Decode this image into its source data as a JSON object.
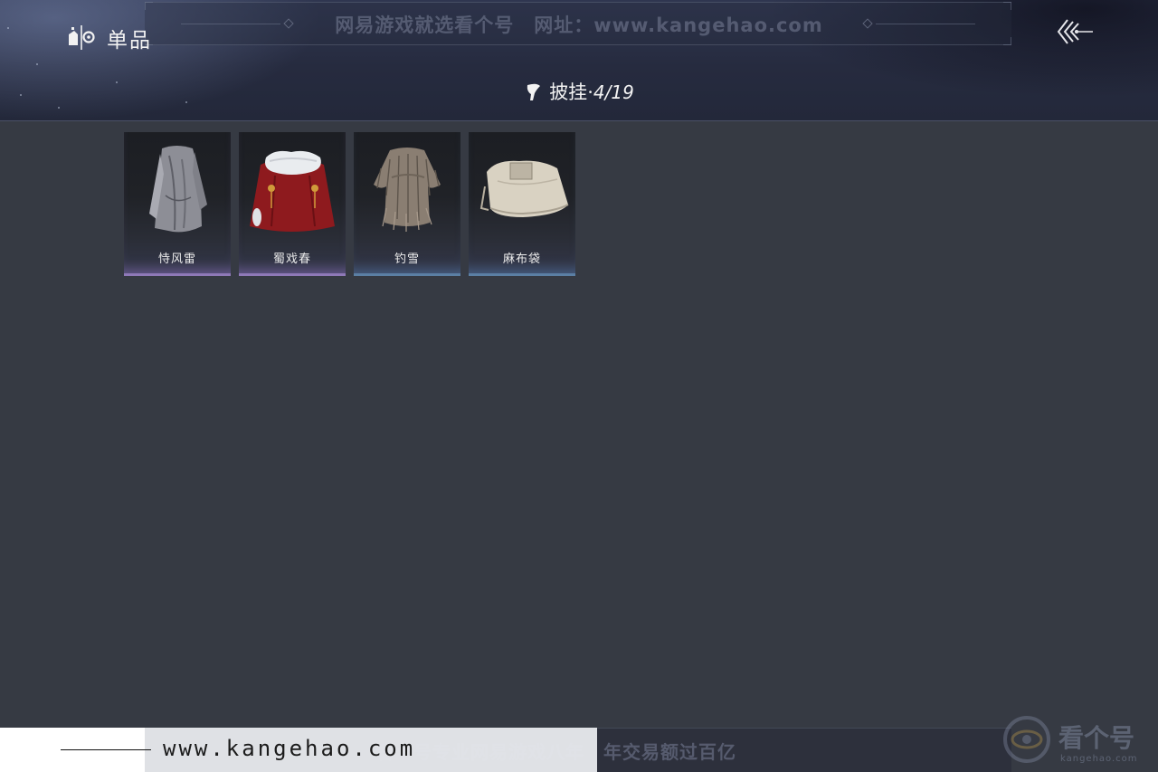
{
  "header": {
    "title": "单品",
    "watermark": "网易游戏就选看个号　网址：www.kangehao.com",
    "logo_icon": "wardrobe-logo-icon",
    "back_icon": "triple-arrow-back-icon"
  },
  "category": {
    "icon": "cape-icon",
    "label": "披挂",
    "separator": "·",
    "count": "4/19"
  },
  "items": [
    {
      "name": "恃风雷",
      "rarity_color": "#8f79b8",
      "icon": "grey-robe-icon"
    },
    {
      "name": "蜀戏春",
      "rarity_color": "#8f79b8",
      "icon": "red-fur-cape-icon"
    },
    {
      "name": "钓雪",
      "rarity_color": "#5b7fa4",
      "icon": "straw-raincoat-icon"
    },
    {
      "name": "麻布袋",
      "rarity_color": "#5b7fa4",
      "icon": "burlap-sack-icon"
    }
  ],
  "footer": {
    "slogan": "看个号专业网易游戏八年　年交易额过百亿",
    "url": "www.kangehao.com",
    "brand": "看个号",
    "brand_sub": "kangehao.com"
  },
  "colors": {
    "background": "#363a43",
    "header": "#262b3f",
    "rarity_purple": "#8f79b8",
    "rarity_blue": "#5b7fa4"
  }
}
